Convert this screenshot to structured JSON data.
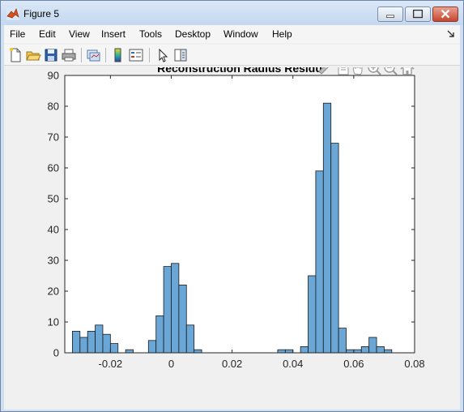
{
  "window": {
    "title": "Figure 5"
  },
  "menu": [
    "File",
    "Edit",
    "View",
    "Insert",
    "Tools",
    "Desktop",
    "Window",
    "Help"
  ],
  "toolbar": {
    "tools": [
      "new-figure-icon",
      "open-file-icon",
      "save-icon",
      "print-icon",
      "link-plot-icon",
      "insert-colorbar-icon",
      "insert-legend-icon",
      "edit-plot-arrow-icon",
      "property-inspector-icon"
    ]
  },
  "axes_toolbar": [
    "brush-icon",
    "data-tips-icon",
    "pan-icon",
    "zoom-in-icon",
    "zoom-out-icon",
    "home-icon"
  ],
  "chart_data": {
    "type": "bar",
    "title": "Reconstruction Radius Residu",
    "bin_width": 0.0025,
    "xlim": [
      -0.035,
      0.08
    ],
    "ylim": [
      0,
      90
    ],
    "xticks": [
      "-0.02",
      "0",
      "0.02",
      "0.04",
      "0.06",
      "0.08"
    ],
    "xtick_values": [
      -0.02,
      0,
      0.02,
      0.04,
      0.06,
      0.08
    ],
    "yticks": [
      "0",
      "10",
      "20",
      "30",
      "40",
      "50",
      "60",
      "70",
      "80",
      "90"
    ],
    "ytick_values": [
      0,
      10,
      20,
      30,
      40,
      50,
      60,
      70,
      80,
      90
    ],
    "bin_edges": [
      -0.0325,
      -0.03,
      -0.0275,
      -0.025,
      -0.0225,
      -0.02,
      -0.0175,
      -0.015,
      -0.0125,
      -0.01,
      -0.0075,
      -0.005,
      -0.0025,
      0,
      0.0025,
      0.005,
      0.0075,
      0.01,
      0.0125,
      0.015,
      0.0175,
      0.02,
      0.0225,
      0.025,
      0.0275,
      0.03,
      0.0325,
      0.035,
      0.0375,
      0.04,
      0.0425,
      0.045,
      0.0475,
      0.05,
      0.0525,
      0.055,
      0.0575,
      0.06,
      0.0625,
      0.065,
      0.0675,
      0.07,
      0.0725,
      0.075
    ],
    "counts": [
      7,
      5,
      7,
      9,
      6,
      3,
      0,
      1,
      0,
      0,
      4,
      12,
      28,
      29,
      22,
      9,
      1,
      0,
      0,
      0,
      0,
      0,
      0,
      0,
      0,
      0,
      0,
      1,
      1,
      0,
      2,
      25,
      59,
      81,
      68,
      8,
      1,
      1,
      2,
      5,
      2,
      1
    ],
    "bar_color": "#6aa7d6",
    "edge_color": "#1a1a1a",
    "grid": false
  }
}
